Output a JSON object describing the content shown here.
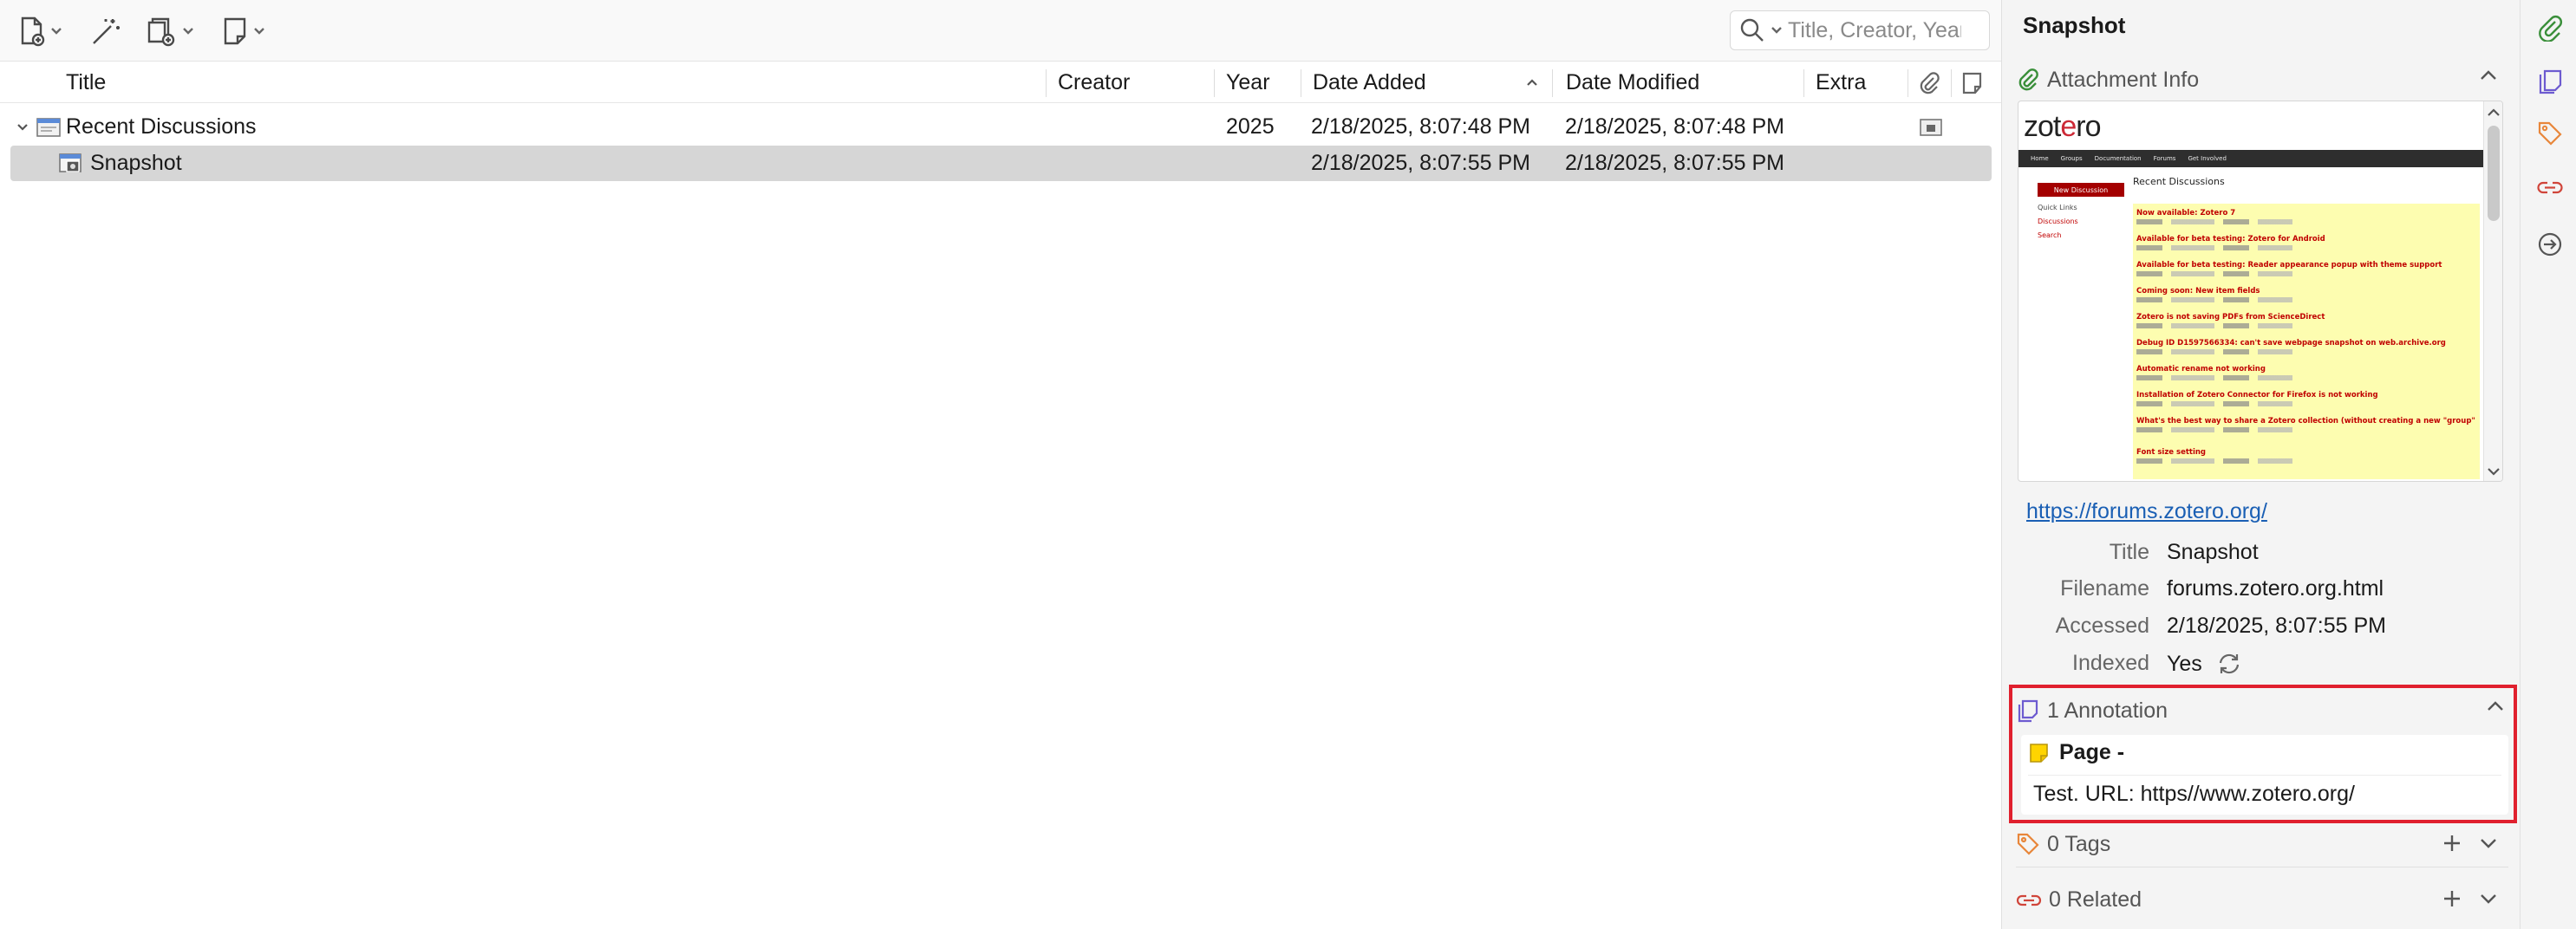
{
  "toolbar": {
    "search_placeholder": "Title, Creator, Year"
  },
  "columns": {
    "title": "Title",
    "creator": "Creator",
    "year": "Year",
    "date_added": "Date Added",
    "date_modified": "Date Modified",
    "extra": "Extra"
  },
  "rows": [
    {
      "title": "Recent Discussions",
      "creator": "",
      "year": "2025",
      "date_added": "2/18/2025, 8:07:48 PM",
      "date_modified": "2/18/2025, 8:07:48 PM"
    },
    {
      "title": "Snapshot",
      "creator": "",
      "year": "",
      "date_added": "2/18/2025, 8:07:55 PM",
      "date_modified": "2/18/2025, 8:07:55 PM"
    }
  ],
  "item_pane": {
    "title": "Snapshot",
    "attachment_info": {
      "heading": "Attachment Info",
      "url": "https://forums.zotero.org/",
      "fields": [
        {
          "label": "Title",
          "value": "Snapshot"
        },
        {
          "label": "Filename",
          "value": "forums.zotero.org.html"
        },
        {
          "label": "Accessed",
          "value": "2/18/2025, 8:07:55 PM"
        },
        {
          "label": "Indexed",
          "value": "Yes"
        }
      ]
    },
    "preview": {
      "logo_a": "zot",
      "logo_b": "e",
      "logo_c": "ro",
      "nav": [
        "Home",
        "Groups",
        "Documentation",
        "Forums",
        "Get Involved"
      ],
      "heading": "Recent Discussions",
      "new_button": "New Discussion",
      "side_links": [
        "Quick Links",
        "Discussions",
        "Search"
      ],
      "items": [
        "Now available: Zotero 7",
        "Available for beta testing: Zotero for Android",
        "Available for beta testing: Reader appearance popup with theme support",
        "Coming soon: New item fields",
        "Zotero is not saving PDFs from ScienceDirect",
        "Debug ID D1597566334: can't save webpage snapshot on web.archive.org",
        "Automatic rename not working",
        "Installation of Zotero Connector for Firefox is not working",
        "What's the best way to share a Zotero collection (without creating a new \"group\" collection)",
        "Font size setting"
      ]
    },
    "annotations": {
      "heading": "1 Annotation",
      "items": [
        {
          "page": "Page -",
          "text": "Test. URL: https//www.zotero.org/"
        }
      ]
    },
    "tags": {
      "heading": "0 Tags"
    },
    "related": {
      "heading": "0 Related"
    }
  },
  "colors": {
    "accent_green": "#3a8f3a",
    "annotation_purple": "#6d5bd0",
    "tag_orange": "#e8863a",
    "related_red": "#d0453a",
    "highlight_box": "#e0202e",
    "note_yellow": "#ffd400"
  }
}
